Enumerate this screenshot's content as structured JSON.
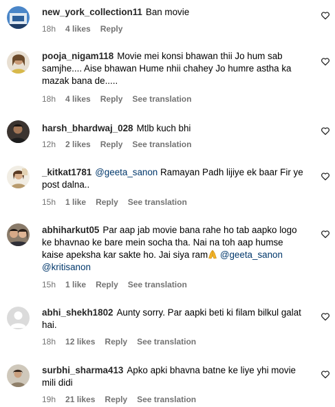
{
  "comments": [
    {
      "username": "new_york_collection11",
      "text": "Ban movie",
      "time": "18h",
      "likes": "4 likes",
      "reply": "Reply",
      "see_translation": ""
    },
    {
      "username": "pooja_nigam118",
      "text": "Movie mei konsi bhawan thii Jo hum sab samjhe.... Aise bhawan Hume nhii chahey Jo humre astha ka mazak bana de.....",
      "time": "18h",
      "likes": "4 likes",
      "reply": "Reply",
      "see_translation": "See translation"
    },
    {
      "username": "harsh_bhardwaj_028",
      "text": "Mtlb kuch bhi",
      "time": "12h",
      "likes": "2 likes",
      "reply": "Reply",
      "see_translation": "See translation"
    },
    {
      "username": "_kitkat1781",
      "mention": "@geeta_sanon",
      "text": "Ramayan Padh lijiye ek baar Fir ye post dalna..",
      "time": "15h",
      "likes": "1 like",
      "reply": "Reply",
      "see_translation": "See translation"
    },
    {
      "username": "abhiharkut05",
      "text": "Par aap jab movie bana rahe ho tab aapko logo ke bhavnao ke bare mein socha tha. Nai na toh aap humse kaise apeksha kar sakte ho. Jai siya ram",
      "mention1": "@geeta_sanon",
      "mention2": "@kritisanon",
      "time": "15h",
      "likes": "1 like",
      "reply": "Reply",
      "see_translation": "See translation"
    },
    {
      "username": "abhi_shekh1802",
      "text": "Aunty sorry. Par aapki beti ki filam bilkul galat hai.",
      "time": "18h",
      "likes": "12 likes",
      "reply": "Reply",
      "see_translation": "See translation"
    },
    {
      "username": "surbhi_sharma413",
      "text": "Apko apki bhavna batne ke liye yhi movie mili didi",
      "time": "19h",
      "likes": "21 likes",
      "reply": "Reply",
      "see_translation": "See translation"
    }
  ],
  "colors": {
    "username": "#262626",
    "meta": "#737373",
    "mention": "#00376b"
  },
  "icons": {
    "like": "heart-outline-icon",
    "emoji": "folded-hands-emoji"
  }
}
